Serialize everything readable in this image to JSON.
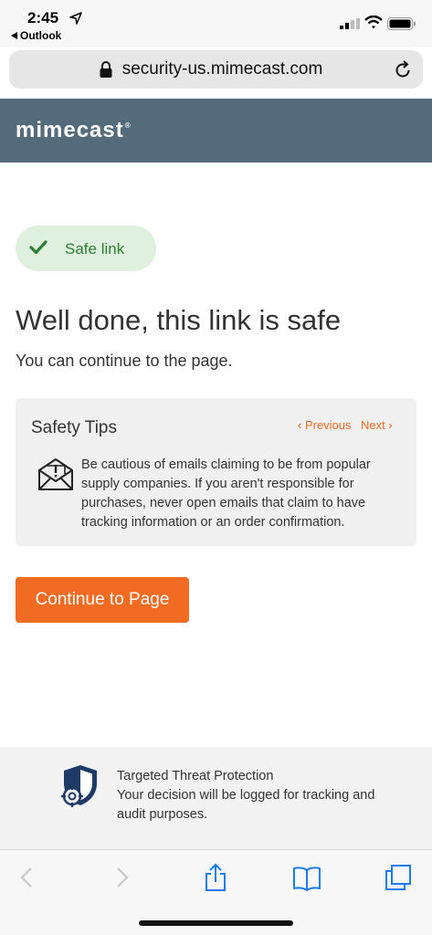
{
  "status_bar": {
    "time": "2:45",
    "back_app": "Outlook"
  },
  "browser": {
    "url": "security-us.mimecast.com"
  },
  "brand": {
    "name": "mimecast",
    "mark": "®",
    "bar_color": "#546b7c"
  },
  "badge": {
    "label": "Safe link",
    "color": "#2e7d32"
  },
  "main": {
    "headline": "Well done, this link is safe",
    "subline": "You can continue to the page."
  },
  "safety_tips": {
    "title": "Safety Tips",
    "previous_label": "Previous",
    "next_label": "Next",
    "text": "Be cautious of emails claiming to be from popular supply companies. If you aren't responsible for purchases, never open emails that claim to have tracking information or an order confirmation."
  },
  "cta": {
    "label": "Continue to Page",
    "color": "#f26b22"
  },
  "footer": {
    "title": "Targeted Threat Protection",
    "text": "Your decision will be logged for tracking and audit purposes."
  },
  "icons": [
    "location-arrow-icon",
    "signal-icon",
    "wifi-icon",
    "battery-icon",
    "lock-icon",
    "reload-icon",
    "check-icon",
    "envelope-alert-icon",
    "shield-target-icon",
    "back-icon",
    "forward-icon",
    "share-icon",
    "bookmarks-icon",
    "tabs-icon"
  ]
}
